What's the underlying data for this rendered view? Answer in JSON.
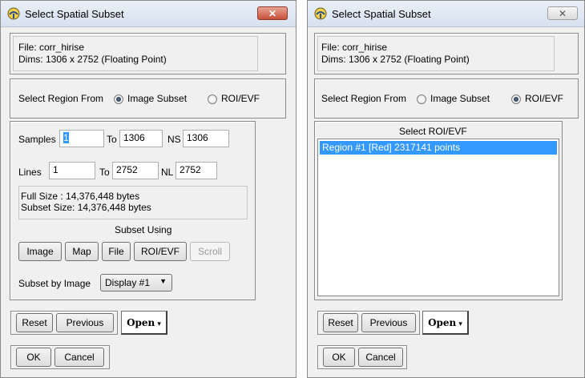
{
  "colors": {
    "selection": "#3399ff",
    "close_active": "#c7503a",
    "window_bg": "#f0f0f0"
  },
  "left": {
    "title": "Select Spatial Subset",
    "close_glyph": "✕",
    "file_label": "File: corr_hirise",
    "dims_label": "Dims: 1306 x 2752 (Floating Point)",
    "region_label": "Select Region From",
    "opt_image_subset": "Image Subset",
    "opt_roi": "ROI/EVF",
    "selected_option": "Image Subset",
    "samples_label": "Samples",
    "samples_value": "1",
    "samples_to_label": "To",
    "samples_to_value": "1306",
    "ns_label": "NS",
    "ns_value": "1306",
    "lines_label": "Lines",
    "lines_value": "1",
    "lines_to_label": "To",
    "lines_to_value": "2752",
    "nl_label": "NL",
    "nl_value": "2752",
    "full_size": "Full Size  : 14,376,448 bytes",
    "subset_size": "Subset Size: 14,376,448 bytes",
    "subset_using": "Subset Using",
    "btn_image": "Image",
    "btn_map": "Map",
    "btn_file": "File",
    "btn_roi": "ROI/EVF",
    "btn_scroll": "Scroll",
    "subset_by_image_label": "Subset by Image",
    "display_value": "Display #1",
    "reset": "Reset",
    "previous": "Previous",
    "open": "Open",
    "ok": "OK",
    "cancel": "Cancel"
  },
  "right": {
    "title": "Select Spatial Subset",
    "close_glyph": "✕",
    "file_label": "File: corr_hirise",
    "dims_label": "Dims: 1306 x 2752 (Floating Point)",
    "region_label": "Select Region From",
    "opt_image_subset": "Image Subset",
    "opt_roi": "ROI/EVF",
    "selected_option": "ROI/EVF",
    "list_title": "Select ROI/EVF",
    "list_items": [
      "Region #1 [Red] 2317141 points"
    ],
    "reset": "Reset",
    "previous": "Previous",
    "open": "Open",
    "ok": "OK",
    "cancel": "Cancel"
  }
}
